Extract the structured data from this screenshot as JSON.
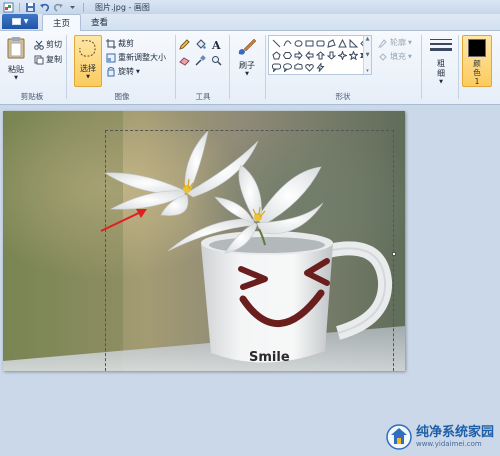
{
  "window": {
    "title": "图片.jpg - 画图"
  },
  "tabs": [
    {
      "label": "主页",
      "active": true
    },
    {
      "label": "查看",
      "active": false
    }
  ],
  "clipboard": {
    "paste": "粘贴",
    "cut": "剪切",
    "copy": "复制",
    "label": "剪贴板"
  },
  "image": {
    "select": "选择",
    "crop": "裁剪",
    "resize": "重新调整大小",
    "rotate": "旋转",
    "label": "图像"
  },
  "tools": {
    "label": "工具"
  },
  "brushes": {
    "label": "刷子"
  },
  "shapes": {
    "outline": "轮廓",
    "fill": "填充",
    "label": "形状"
  },
  "size": {
    "label": "粗细"
  },
  "colors": {
    "color1": "颜色 1",
    "color1_value": "#000000"
  },
  "watermark": {
    "title": "纯净系统家园",
    "url": "www.yidaimei.com"
  },
  "accent": {
    "selected": "#fbcb5e",
    "arrow": "#e02020"
  }
}
